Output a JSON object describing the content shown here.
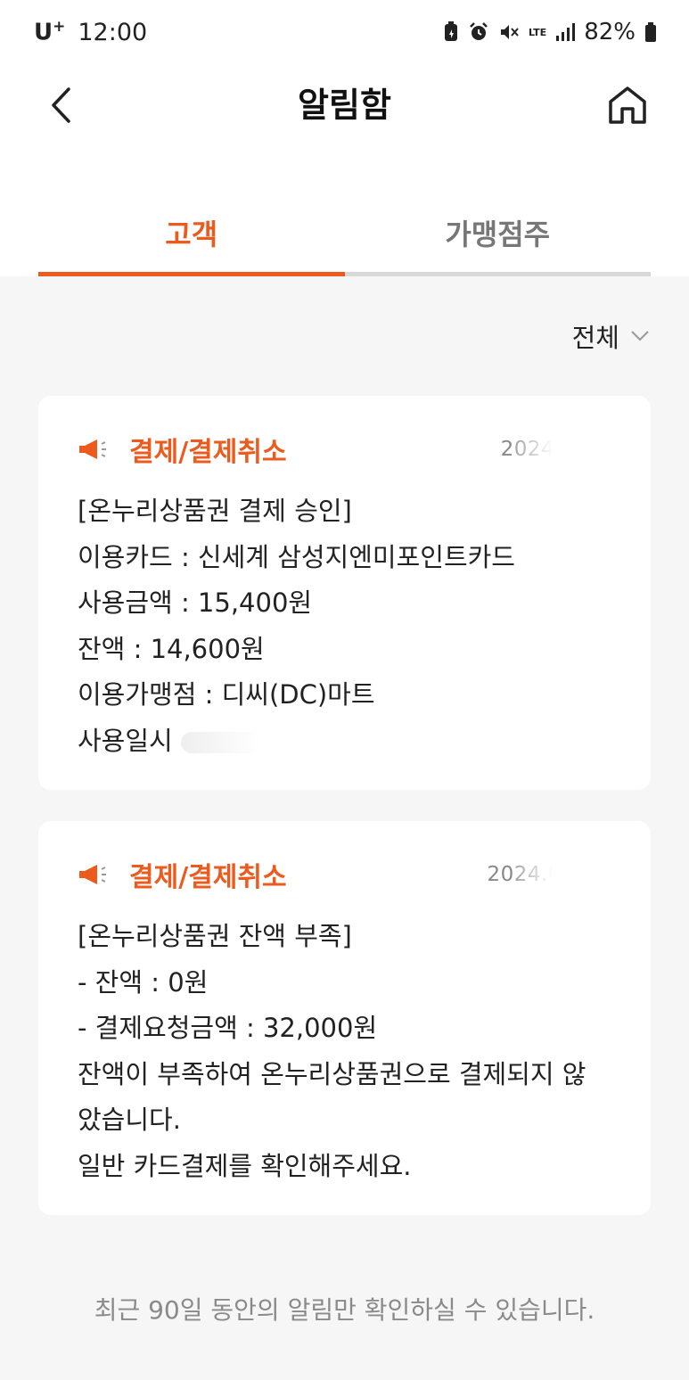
{
  "status_bar": {
    "carrier": "U",
    "carrier_sup": "+",
    "time": "12:00",
    "network": "LTE",
    "battery": "82%"
  },
  "header": {
    "title": "알림함"
  },
  "tabs": [
    {
      "label": "고객",
      "active": true
    },
    {
      "label": "가맹점주",
      "active": false
    }
  ],
  "filter": {
    "label": "전체"
  },
  "notifications": [
    {
      "category": "결제/결제취소",
      "date": "2024.",
      "lines": [
        "[온누리상품권 결제 승인]",
        "이용카드 : 신세계 삼성지엔미포인트카드",
        "사용금액 : 15,400원",
        "잔액 : 14,600원",
        "이용가맹점 : 디씨(DC)마트",
        "사용일시"
      ]
    },
    {
      "category": "결제/결제취소",
      "date": "2024.0",
      "lines": [
        "[온누리상품권 잔액 부족]",
        "- 잔액 : 0원",
        "- 결제요청금액 : 32,000원",
        "잔액이 부족하여 온누리상품권으로 결제되지 않",
        "았습니다.",
        "일반 카드결제를 확인해주세요."
      ]
    }
  ],
  "footer": {
    "note": "최근 90일 동안의 알림만 확인하실 수 있습니다."
  },
  "colors": {
    "accent": "#ec5a1e",
    "background": "#f6f6f6",
    "card": "#ffffff"
  }
}
